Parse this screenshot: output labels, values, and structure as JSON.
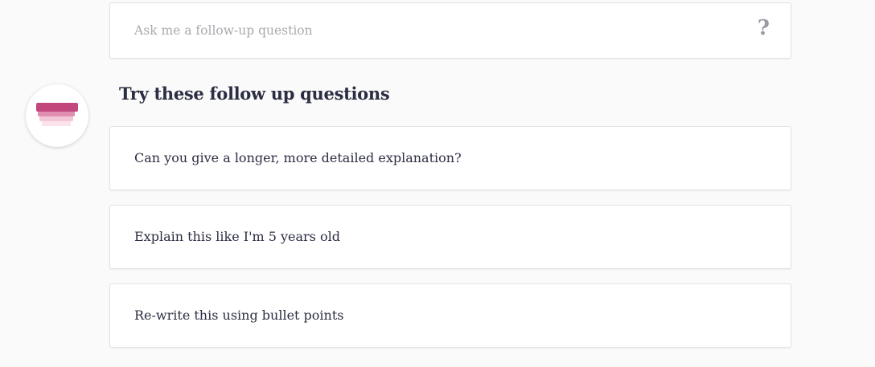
{
  "followup": {
    "placeholder": "Ask me a follow-up question",
    "value": "",
    "help_icon": "?"
  },
  "avatar": {
    "icon": "stacked-layers-icon",
    "colors": [
      "#c2477c",
      "#e08fb0",
      "#f3c6d8",
      "#fbe3ec"
    ]
  },
  "suggestions": {
    "heading": "Try these follow up questions",
    "items": [
      {
        "label": "Can you give a longer, more detailed explanation?"
      },
      {
        "label": "Explain this like I'm 5 years old"
      },
      {
        "label": "Re-write this using bullet points"
      }
    ]
  }
}
